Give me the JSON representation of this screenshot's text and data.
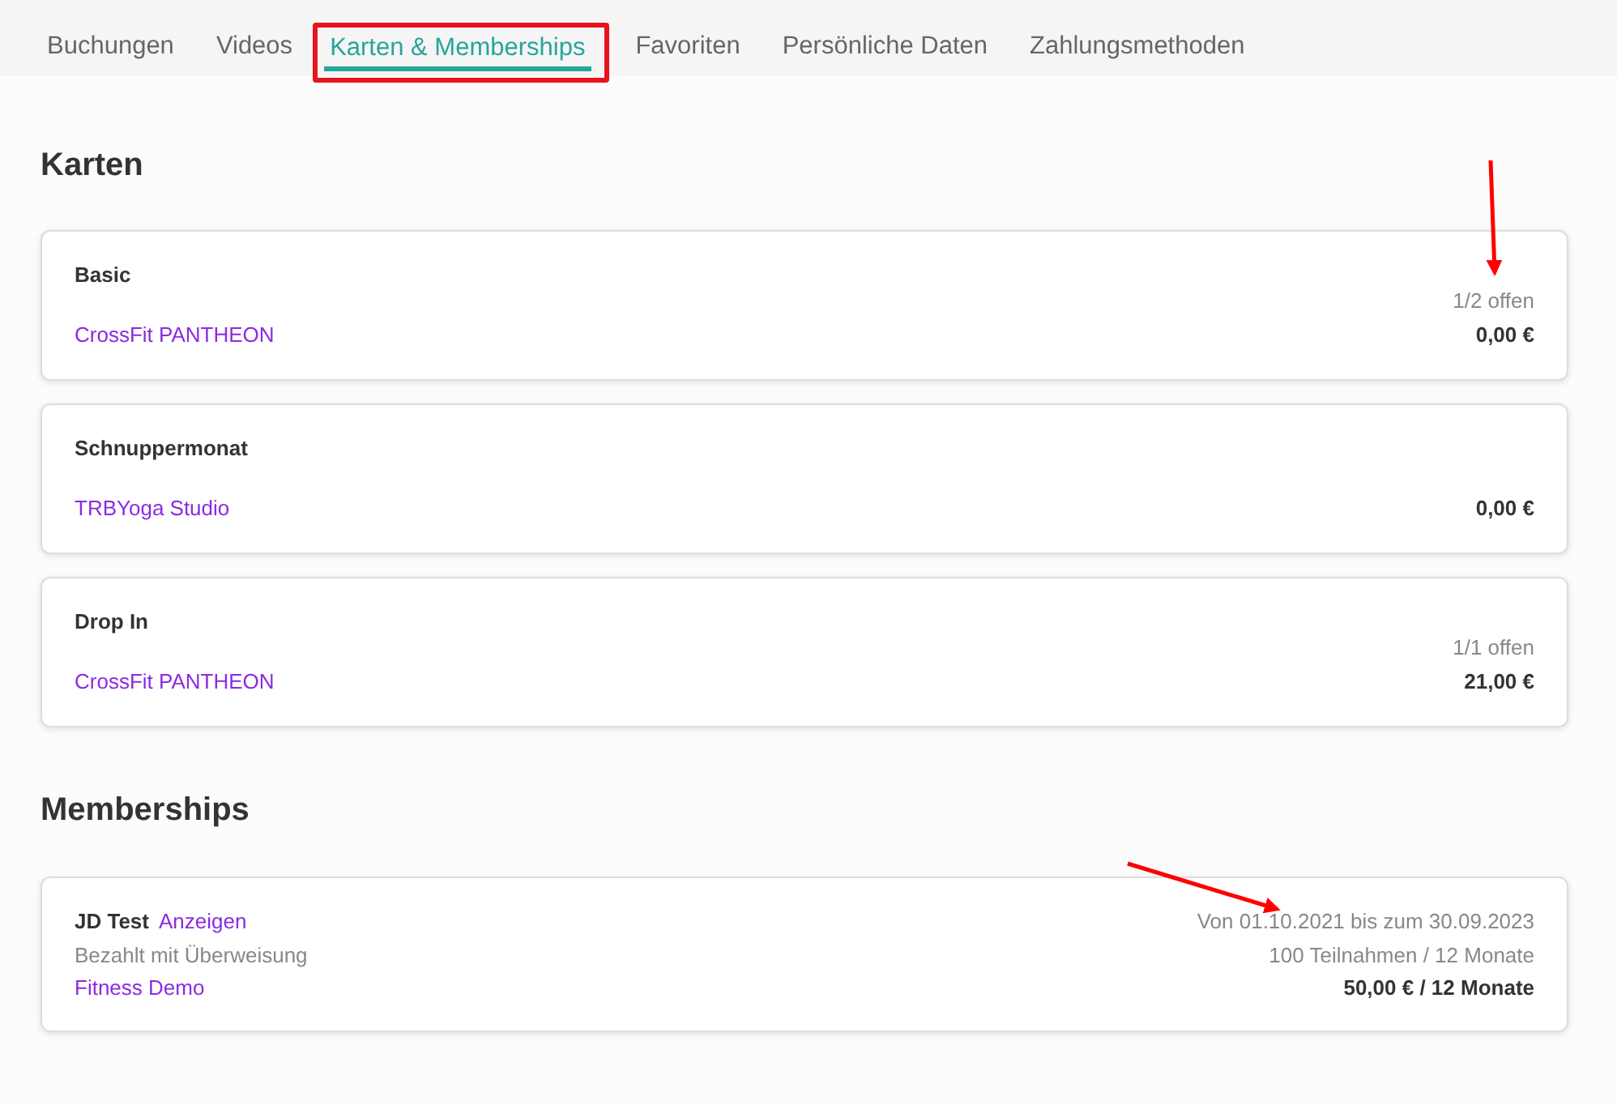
{
  "tabs": [
    {
      "label": "Buchungen",
      "selected": false
    },
    {
      "label": "Videos",
      "selected": false
    },
    {
      "label": "Karten & Memberships",
      "selected": true
    },
    {
      "label": "Favoriten",
      "selected": false
    },
    {
      "label": "Persönliche Daten",
      "selected": false
    },
    {
      "label": "Zahlungsmethoden",
      "selected": false
    }
  ],
  "cards": {
    "heading": "Karten",
    "items": [
      {
        "name": "Basic",
        "studio": "CrossFit PANTHEON",
        "remaining": "1/2 offen",
        "price": "0,00 €"
      },
      {
        "name": "Schnuppermonat",
        "studio": "TRBYoga Studio",
        "price": "0,00 €"
      },
      {
        "name": "Drop In",
        "studio": "CrossFit PANTHEON",
        "remaining": "1/1 offen",
        "price": "21,00 €"
      }
    ]
  },
  "memberships": {
    "heading": "Memberships",
    "items": [
      {
        "name": "JD Test",
        "link": "Anzeigen",
        "payment": "Bezahlt mit Überweisung",
        "studio": "Fitness Demo",
        "period": "Von 01.10.2021 bis zum 30.09.2023",
        "usage": "100 Teilnahmen / 12 Monate",
        "price": "50,00 € / 12 Monate"
      }
    ]
  }
}
